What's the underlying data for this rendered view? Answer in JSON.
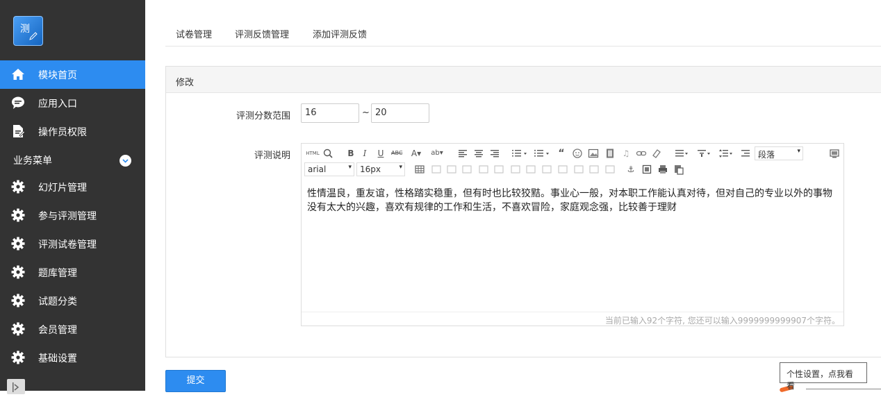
{
  "sidebar": {
    "logo_char": "测",
    "items": [
      {
        "label": "模块首页",
        "icon": "home-icon",
        "active": true
      },
      {
        "label": "应用入口",
        "icon": "chat-icon",
        "active": false
      },
      {
        "label": "操作员权限",
        "icon": "document-icon",
        "active": false
      }
    ],
    "section_label": "业务菜单",
    "menu": [
      {
        "label": "幻灯片管理",
        "icon": "gear-icon"
      },
      {
        "label": "参与评测管理",
        "icon": "gear-icon"
      },
      {
        "label": "评测试卷管理",
        "icon": "gear-icon"
      },
      {
        "label": "题库管理",
        "icon": "gear-icon"
      },
      {
        "label": "试题分类",
        "icon": "gear-icon"
      },
      {
        "label": "会员管理",
        "icon": "gear-icon"
      },
      {
        "label": "基础设置",
        "icon": "gear-icon"
      }
    ]
  },
  "tabs": [
    "试卷管理",
    "评测反馈管理",
    "添加评测反馈"
  ],
  "panel": {
    "title": "修改",
    "score_label": "评测分数范围",
    "score_min": "16",
    "score_separator": "~",
    "score_max": "20",
    "desc_label": "评测说明"
  },
  "editor": {
    "font_family": "arial",
    "font_size": "16px",
    "paragraph": "段落",
    "content": "性情温良，重友谊，性格踏实稳重，但有时也比较狡黠。事业心一般，对本职工作能认真对待，但对自己的专业以外的事物没有太大的兴趣，喜欢有规律的工作和生活，不喜欢冒险，家庭观念强，比较善于理财",
    "counter": "当前已输入92个字符, 您还可以输入9999999999907个字符。"
  },
  "submit_label": "提交",
  "tooltip": "个性设置，点我看看",
  "colors": {
    "sidebar_bg": "#333333",
    "accent": "#2d8cf0"
  }
}
